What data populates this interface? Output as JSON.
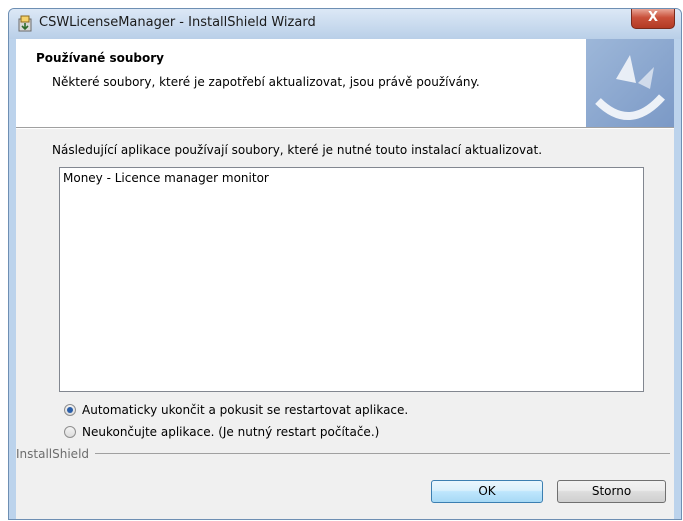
{
  "window": {
    "title": "CSWLicenseManager - InstallShield Wizard",
    "close_label": "X"
  },
  "header": {
    "title": "Používané soubory",
    "subtitle": "Některé soubory, které je zapotřebí aktualizovat, jsou právě používány."
  },
  "body": {
    "description": "Následující aplikace používají soubory, které je nutné touto instalací aktualizovat.",
    "list_items": [
      "Money - Licence manager monitor"
    ],
    "options": [
      {
        "label": "Automaticky ukončit a pokusit se restartovat aplikace.",
        "checked": true
      },
      {
        "label": "Neukončujte aplikace. (Je nutný restart počítače.)",
        "checked": false
      }
    ]
  },
  "footer": {
    "brand": "InstallShield",
    "ok_label": "OK",
    "cancel_label": "Storno"
  }
}
